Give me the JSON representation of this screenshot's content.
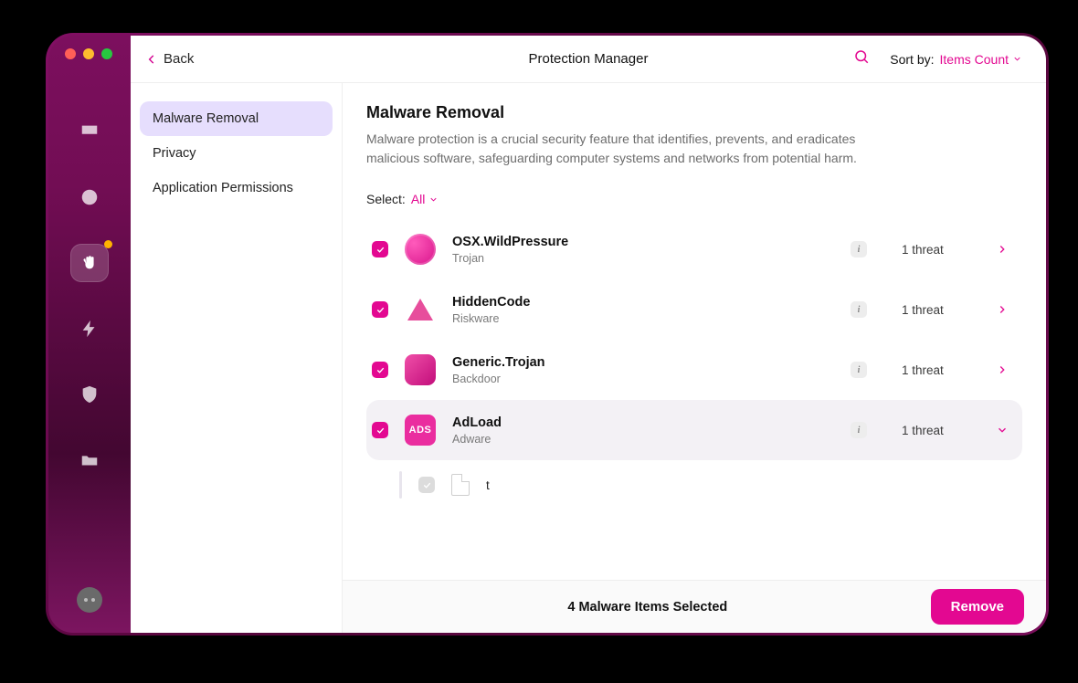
{
  "header": {
    "back_label": "Back",
    "title": "Protection Manager",
    "sort_label": "Sort by:",
    "sort_value": "Items Count"
  },
  "categories": [
    {
      "label": "Malware Removal",
      "selected": true
    },
    {
      "label": "Privacy",
      "selected": false
    },
    {
      "label": "Application Permissions",
      "selected": false
    }
  ],
  "section": {
    "heading": "Malware Removal",
    "description": "Malware protection is a crucial security feature that identifies, prevents, and eradicates malicious software, safeguarding computer systems and networks from potential harm.",
    "select_label": "Select:",
    "select_value": "All"
  },
  "threats": [
    {
      "name": "OSX.WildPressure",
      "kind": "Trojan",
      "count_text": "1 threat",
      "checked": true,
      "expanded": false,
      "icon": "clock"
    },
    {
      "name": "HiddenCode",
      "kind": "Riskware",
      "count_text": "1 threat",
      "checked": true,
      "expanded": false,
      "icon": "triangle"
    },
    {
      "name": "Generic.Trojan",
      "kind": "Backdoor",
      "count_text": "1 threat",
      "checked": true,
      "expanded": false,
      "icon": "door"
    },
    {
      "name": "AdLoad",
      "kind": "Adware",
      "count_text": "1 threat",
      "checked": true,
      "expanded": true,
      "icon": "ads",
      "children": [
        {
          "name": "t",
          "checked": true
        }
      ]
    }
  ],
  "footer": {
    "status": "4 Malware Items Selected",
    "remove_label": "Remove"
  }
}
